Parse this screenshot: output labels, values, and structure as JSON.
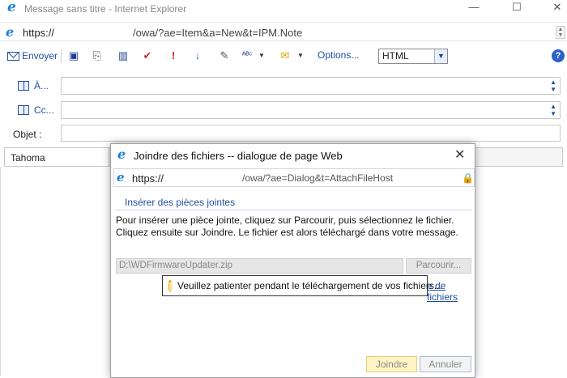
{
  "window": {
    "title": "Message sans titre - Internet Explorer",
    "controls": {
      "minimize": "—",
      "maximize": "☐",
      "close": "✕"
    }
  },
  "address_bar": {
    "scheme": "https://",
    "path": "/owa/?ae=Item&a=New&t=IPM.Note"
  },
  "toolbar": {
    "send_label": "Envoyer",
    "options_label": "Options...",
    "format_value": "HTML",
    "icons": [
      "save-icon",
      "attach-icon",
      "address-book-icon",
      "check-names-icon",
      "importance-high-icon",
      "importance-low-icon",
      "signature-icon",
      "spell-check-icon",
      "flag-icon",
      "options-icon",
      "help-icon"
    ]
  },
  "recipients": {
    "to_label": "À...",
    "cc_label": "Cc...",
    "subject_label": "Objet :"
  },
  "font_bar": {
    "font_value": "Tahoma"
  },
  "dialog": {
    "title": "Joindre des fichiers -- dialogue de page Web",
    "close": "✕",
    "address_scheme": "https://",
    "address_path": "/owa/?ae=Dialog&t=AttachFileHost",
    "section_title": "Insérer des pièces jointes",
    "instructions": "Pour insérer une pièce jointe, cliquez sur Parcourir, puis sélectionnez le fichier. Cliquez ensuite sur Joindre. Le fichier est alors téléchargé dans votre message.",
    "file_value": "D:\\WDFirmwareUpdater.zip",
    "browse_label": "Parcourir...",
    "attached_link": "e de fichiers",
    "wait_message": "Veuillez patienter pendant le téléchargement de vos fichiers...",
    "join_label": "Joindre",
    "cancel_label": "Annuler"
  },
  "colors": {
    "accent": "#1f4fa0",
    "ie_blue": "#1c7fd6",
    "join_bg": "#fff4c4"
  }
}
